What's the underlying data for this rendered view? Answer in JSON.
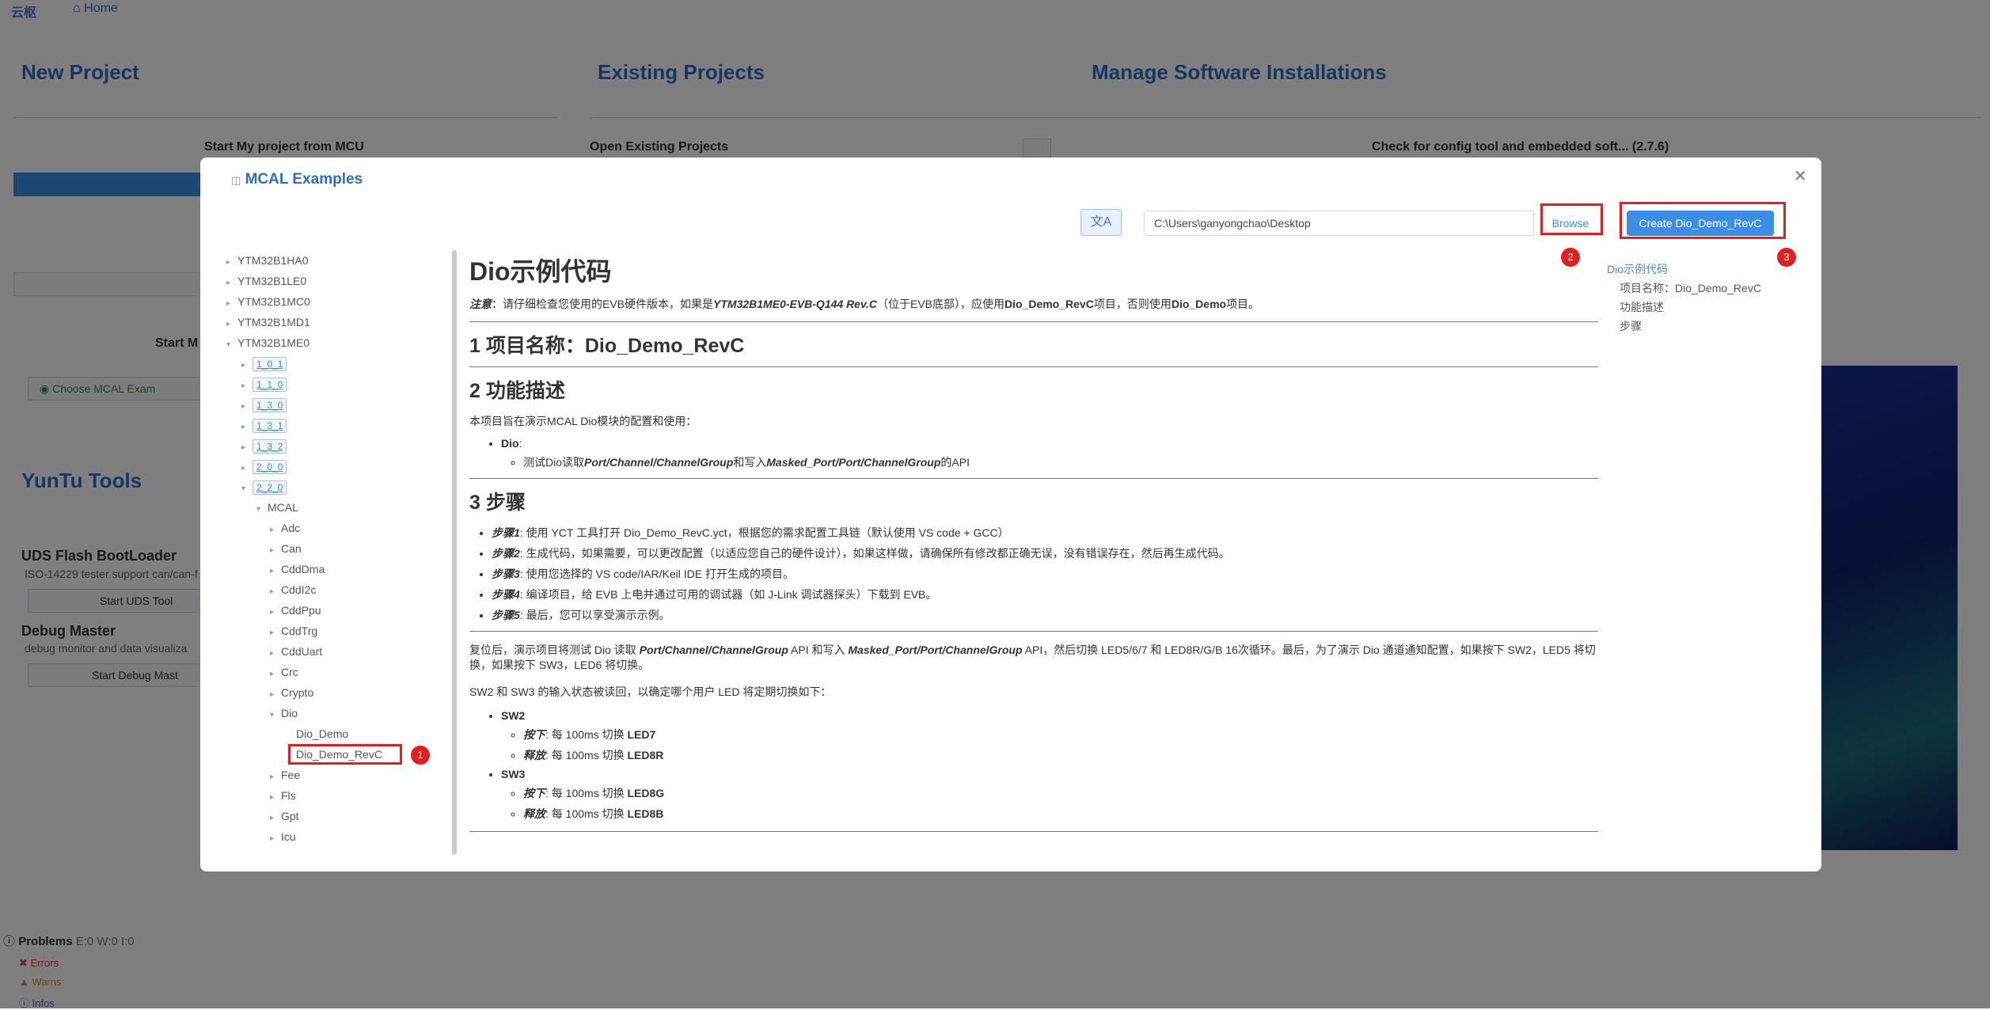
{
  "topbar": {
    "logo": "云枢",
    "home": "Home"
  },
  "background": {
    "new_project": "New Project",
    "existing_projects": "Existing Projects",
    "manage_software": "Manage Software Installations",
    "start_mcu": "Start My project from MCU",
    "open_existing": "Open Existing Projects",
    "check_config": "Check for config tool and embedded soft... (2.7.6)",
    "start_m": "Start M",
    "choose_mcal": "Choose MCAL Exam",
    "yuntu_tools": "YunTu Tools",
    "uds_title": "UDS Flash BootLoader",
    "uds_desc": "ISO-14229 tester support can/can-f",
    "uds_btn": "Start UDS Tool",
    "debug_title": "Debug Master",
    "debug_desc": "debug monitor and data visualiza",
    "debug_btn": "Start Debug Mast"
  },
  "problems": {
    "title": "Problems",
    "counts": "E:0 W:0 I:0",
    "errors": "Errors",
    "warns": "Warns",
    "infos": "Infos"
  },
  "modal": {
    "title": "MCAL Examples",
    "path": "C:\\Users\\ganyongchao\\Desktop",
    "browse": "Browse",
    "create": "Create Dio_Demo_RevC",
    "badges": [
      "1",
      "2",
      "3"
    ]
  },
  "tree": {
    "chips": [
      "YTM32B1HA0",
      "YTM32B1LE0",
      "YTM32B1MC0",
      "YTM32B1MD1",
      "YTM32B1ME0"
    ],
    "versions": [
      "1_0_1",
      "1_1_0",
      "1_3_0",
      "1_3_1",
      "1_3_2",
      "2_0_0",
      "2_2_0"
    ],
    "mcal": "MCAL",
    "modules_before": [
      "Adc",
      "Can",
      "CddDma",
      "CddI2c",
      "CddPpu",
      "CddTrg",
      "CddUart",
      "Crc",
      "Crypto"
    ],
    "dio": "Dio",
    "dio_children": [
      "Dio_Demo",
      "Dio_Demo_RevC"
    ],
    "modules_after": [
      "Fee",
      "Fls",
      "Gpt",
      "Icu"
    ]
  },
  "doc": {
    "h1": "Dio示例代码",
    "note_label": "注意",
    "note_a": "：请仔细检查您使用的EVB硬件版本，如果是",
    "note_board": "YTM32B1ME0-EVB-Q144 Rev.C",
    "note_b": "（位于EVB底部），应使用",
    "note_proj1": "Dio_Demo_RevC",
    "note_c": "项目，否则使用",
    "note_proj2": "Dio_Demo",
    "note_d": "项目。",
    "s1": "1 项目名称：Dio_Demo_RevC",
    "s2": "2 功能描述",
    "s2_intro": "本项目旨在演示MCAL Dio模块的配置和使用：",
    "s2_dio": "Dio",
    "s2_dio_colon": ":",
    "s2_sub_a": "测试Dio读取",
    "s2_sub_b": "Port/Channel/ChannelGroup",
    "s2_sub_c": "和写入",
    "s2_sub_d": "Masked_Port/Port/ChannelGroup",
    "s2_sub_e": "的API",
    "s3": "3 步骤",
    "steps": [
      {
        "label": "步骤1",
        "text": ": 使用 YCT 工具打开 Dio_Demo_RevC.yct，根据您的需求配置工具链（默认使用 VS code + GCC）"
      },
      {
        "label": "步骤2",
        "text": ": 生成代码，如果需要，可以更改配置（以适应您自己的硬件设计），如果这样做，请确保所有修改都正确无误，没有错误存在，然后再生成代码。"
      },
      {
        "label": "步骤3",
        "text": ": 使用您选择的 VS code/IAR/Keil IDE 打开生成的项目。"
      },
      {
        "label": "步骤4",
        "text": ": 编译项目，给 EVB 上电并通过可用的调试器（如 J-Link 调试器探头）下载到 EVB。"
      },
      {
        "label": "步骤5",
        "text": ": 最后，您可以享受演示示例。"
      }
    ],
    "para1_a": "复位后，演示项目将测试 Dio 读取 ",
    "para1_b": "Port/Channel/ChannelGroup",
    "para1_c": " API 和写入 ",
    "para1_d": "Masked_Port/Port/ChannelGroup",
    "para1_e": " API，然后切换 LED5/6/7 和 LED8R/G/B 16次循环。最后，为了演示 Dio 通道通知配置，如果按下 SW2，LED5 将切",
    "para1_f": "换，如果按下 SW3，LED6 将切换。",
    "para2": "SW2 和 SW3 的输入状态被读回，以确定哪个用户 LED 将定期切换如下：",
    "sw2": "SW2",
    "sw2_press_label": "按下",
    "sw2_press_text": ": 每 100ms 切换 ",
    "sw2_press_led": "LED7",
    "sw2_release_label": "释放",
    "sw2_release_text": ": 每 100ms 切换 ",
    "sw2_release_led": "LED8R",
    "sw3": "SW3",
    "sw3_press_label": "按下",
    "sw3_press_text": ": 每 100ms 切换 ",
    "sw3_press_led": "LED8G",
    "sw3_release_label": "释放",
    "sw3_release_text": ": 每 100ms 切换 ",
    "sw3_release_led": "LED8B"
  },
  "toc": {
    "title": "Dio示例代码",
    "items": [
      "项目名称：Dio_Demo_RevC",
      "功能描述",
      "步骤"
    ]
  },
  "colors": {
    "accent": "#3a8ee6",
    "title_blue": "#2d6fc2",
    "highlight_red": "#e31f1f"
  }
}
